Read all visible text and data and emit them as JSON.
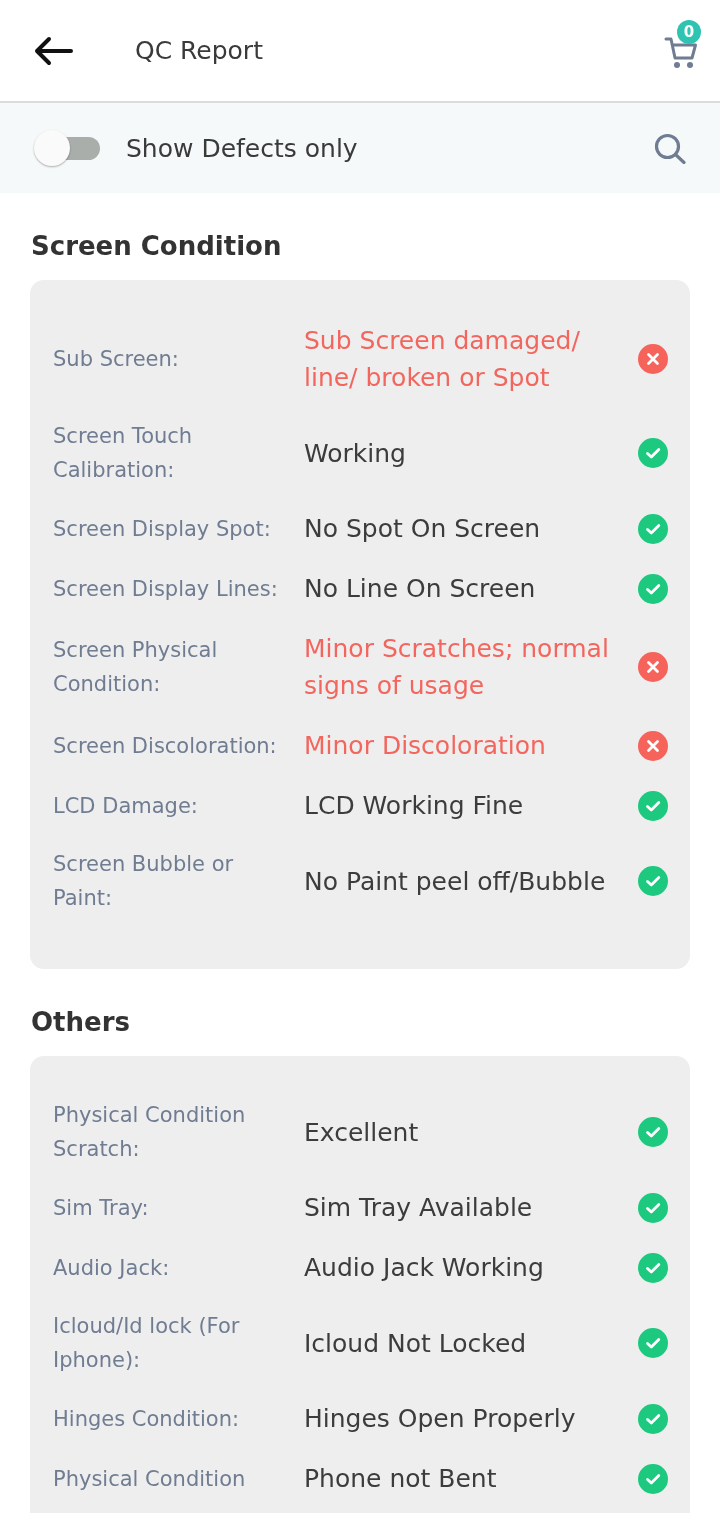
{
  "header": {
    "title": "QC Report",
    "cart_count": "0"
  },
  "filter": {
    "label": "Show Defects only",
    "on": false
  },
  "sections": [
    {
      "title": "Screen Condition",
      "items": [
        {
          "label": "Sub Screen:",
          "value": "Sub Screen damaged/ line/ broken or Spot",
          "defect": true
        },
        {
          "label": "Screen Touch Calibration:",
          "value": "Working",
          "defect": false
        },
        {
          "label": "Screen Display Spot:",
          "value": "No Spot On Screen",
          "defect": false
        },
        {
          "label": "Screen Display Lines:",
          "value": "No Line On Screen",
          "defect": false
        },
        {
          "label": "Screen Physical Condition:",
          "value": "Minor Scratches; normal signs of usage",
          "defect": true
        },
        {
          "label": "Screen Discoloration:",
          "value": "Minor Discoloration",
          "defect": true
        },
        {
          "label": "LCD Damage:",
          "value": "LCD Working Fine",
          "defect": false
        },
        {
          "label": "Screen Bubble or Paint:",
          "value": "No Paint peel off/Bubble",
          "defect": false
        }
      ]
    },
    {
      "title": "Others",
      "items": [
        {
          "label": "Physical Condition Scratch:",
          "value": "Excellent",
          "defect": false
        },
        {
          "label": "Sim Tray:",
          "value": "Sim Tray Available",
          "defect": false
        },
        {
          "label": "Audio Jack:",
          "value": "Audio Jack Working",
          "defect": false
        },
        {
          "label": "Icloud/Id lock (For Iphone):",
          "value": "Icloud Not Locked",
          "defect": false
        },
        {
          "label": "Hinges Condition:",
          "value": "Hinges Open Properly",
          "defect": false
        },
        {
          "label": "Physical Condition",
          "value": "Phone not Bent",
          "defect": false
        }
      ]
    }
  ]
}
